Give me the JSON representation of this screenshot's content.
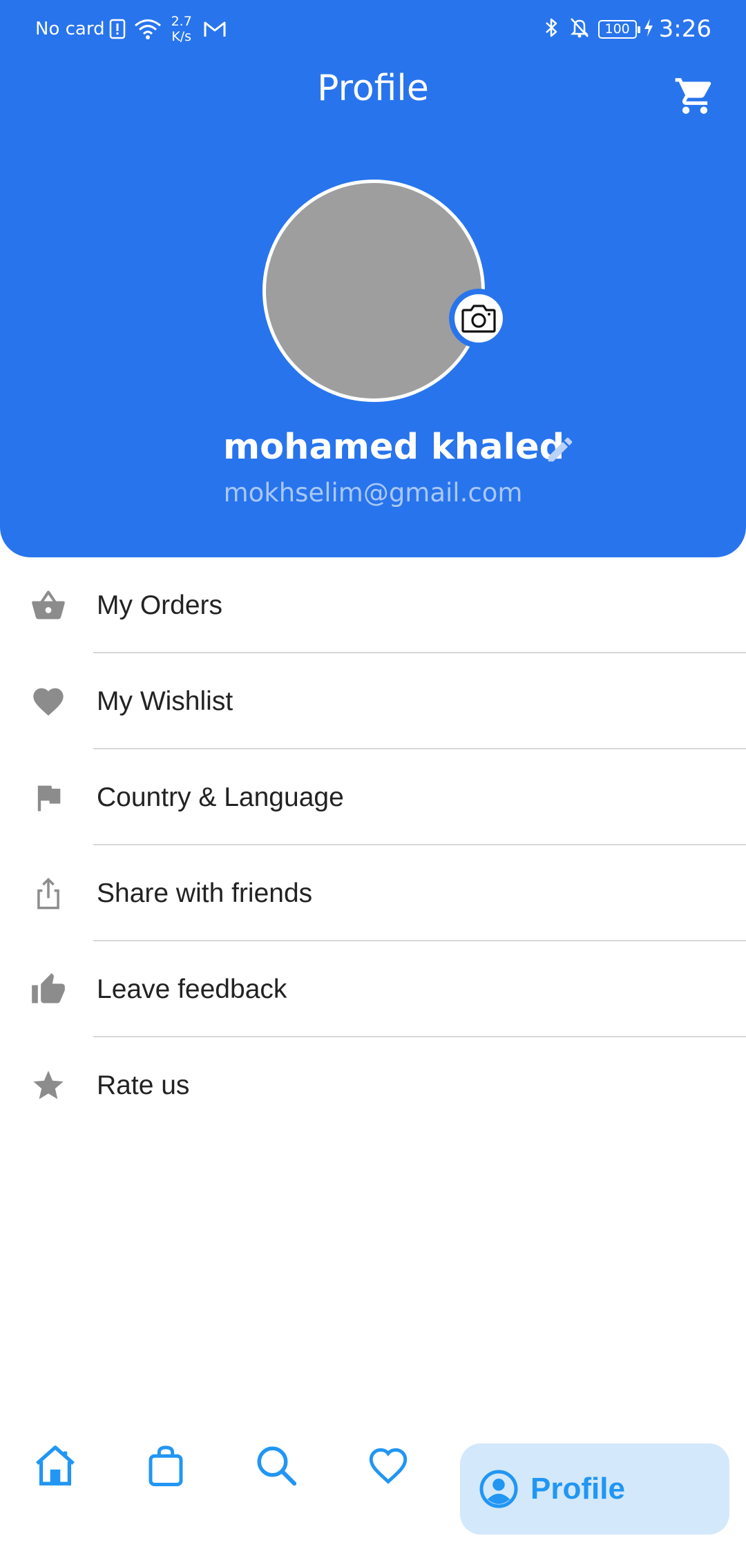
{
  "status_bar": {
    "carrier": "No card",
    "speed_value": "2.7",
    "speed_unit": "K/s",
    "battery": "100",
    "time": "3:26"
  },
  "header": {
    "title": "Profile",
    "cart_icon": "shopping-cart-icon",
    "background_color": "#2874ED"
  },
  "profile": {
    "name": "mohamed khaled",
    "email": "mokhselim@gmail.com",
    "avatar_color": "#9E9E9E",
    "camera_icon": "camera-icon",
    "edit_icon": "pencil-icon"
  },
  "menu": {
    "items": [
      {
        "label": "My Orders",
        "icon": "basket-icon"
      },
      {
        "label": "My Wishlist",
        "icon": "heart-icon"
      },
      {
        "label": "Country & Language",
        "icon": "flag-icon"
      },
      {
        "label": "Share with friends",
        "icon": "share-icon"
      },
      {
        "label": "Leave feedback",
        "icon": "thumbs-up-icon"
      },
      {
        "label": "Rate us",
        "icon": "star-icon"
      }
    ]
  },
  "bottom_nav": {
    "active_color": "#2196F3",
    "items": [
      {
        "icon": "home-icon"
      },
      {
        "icon": "shopping-bag-icon"
      },
      {
        "icon": "search-icon"
      },
      {
        "icon": "heart-icon"
      }
    ],
    "active_label": "Profile"
  }
}
